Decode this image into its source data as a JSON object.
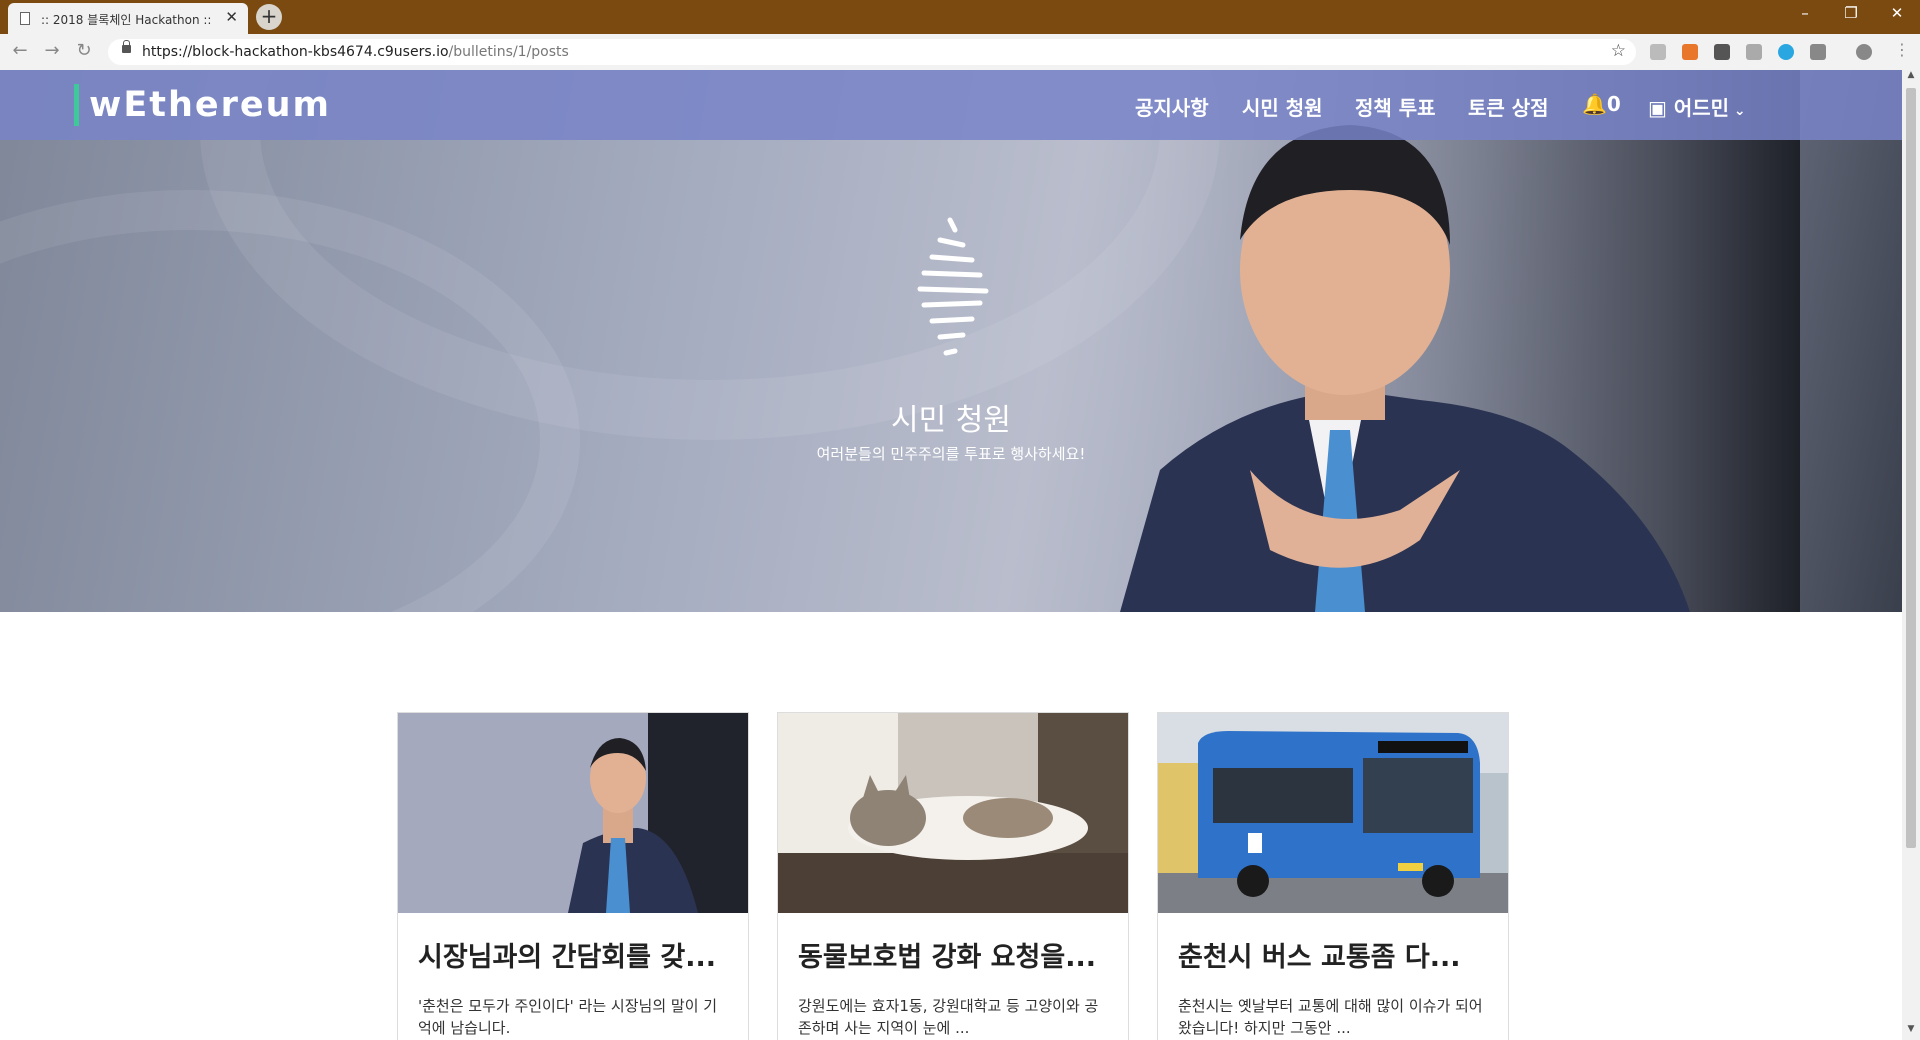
{
  "browser": {
    "tab_title": ":: 2018 블록체인 Hackathon ::",
    "url_host": "https://block-hackathon-kbs4674.c9users.io",
    "url_path": "/bulletins/1/posts"
  },
  "navbar": {
    "brand": "wEthereum",
    "menu": [
      "공지사항",
      "시민 청원",
      "정책 투표",
      "토큰 상점"
    ],
    "notification_count": "0",
    "user_label": "어드민"
  },
  "hero": {
    "title": "시민 청원",
    "subtitle": "여러분들의 민주주의를 투표로 행사하세요!"
  },
  "posts": [
    {
      "title": "시장님과의 간담회를 갖...",
      "excerpt": "'춘천은 모두가 주인이다' 라는 시장님의 말이 기억에 남습니다."
    },
    {
      "title": "동물보호법 강화 요청을...",
      "excerpt": "강원도에는 효자1동, 강원대학교 등 고양이와 공존하며 사는 지역이 눈에 ..."
    },
    {
      "title": "춘천시 버스 교통좀 다...",
      "excerpt": "춘천시는 옛날부터 교통에 대해 많이 이슈가 되어왔습니다! 하지만 그동안 ..."
    }
  ],
  "colors": {
    "tabbar": "#7a4a10",
    "navbar": "#7884c8",
    "brand_accent": "#3fc99a",
    "bus_blue": "#2f72c9"
  }
}
